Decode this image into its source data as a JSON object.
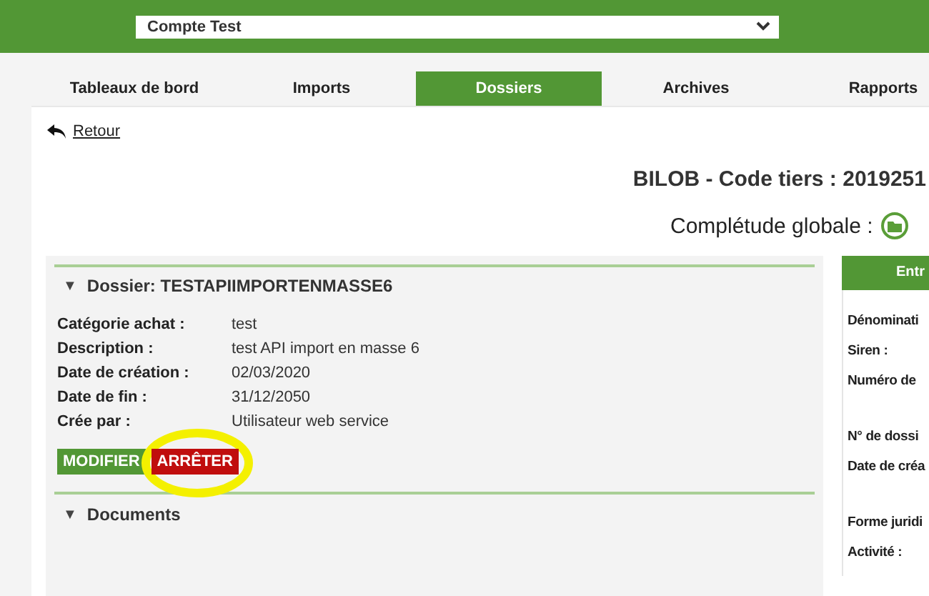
{
  "header": {
    "account_select": {
      "value": "Compte Test"
    }
  },
  "tabs": [
    {
      "label": "Tableaux de bord",
      "selected": false
    },
    {
      "label": "Imports",
      "selected": false
    },
    {
      "label": "Dossiers",
      "selected": true
    },
    {
      "label": "Archives",
      "selected": false
    },
    {
      "label": "Rapports",
      "selected": false
    }
  ],
  "back_link": "Retour",
  "title": "BILOB - Code tiers : 2019251",
  "completeness": {
    "label": "Complétude globale :"
  },
  "dossier": {
    "title": "Dossier: TESTAPIIMPORTENMASSE6",
    "toggle": "▼",
    "fields": [
      {
        "label": "Catégorie achat :",
        "value": "test"
      },
      {
        "label": "Description :",
        "value": "test API import en masse 6"
      },
      {
        "label": "Date de création :",
        "value": "02/03/2020"
      },
      {
        "label": "Date de fin :",
        "value": "31/12/2050"
      },
      {
        "label": "Crée par :",
        "value": "Utilisateur web service"
      }
    ],
    "buttons": [
      {
        "label": "MODIFIER",
        "kind": "edit"
      },
      {
        "label": "ARRÊTER",
        "kind": "stop",
        "highlighted": true
      }
    ]
  },
  "documents": {
    "title": "Documents",
    "toggle": "▼"
  },
  "entreprise": {
    "tab": "Entr",
    "labels": [
      "Dénominati",
      "Siren :",
      "Numéro de",
      "N° de dossi",
      "Date de créa",
      "Forme juridi",
      "Activité :"
    ]
  }
}
